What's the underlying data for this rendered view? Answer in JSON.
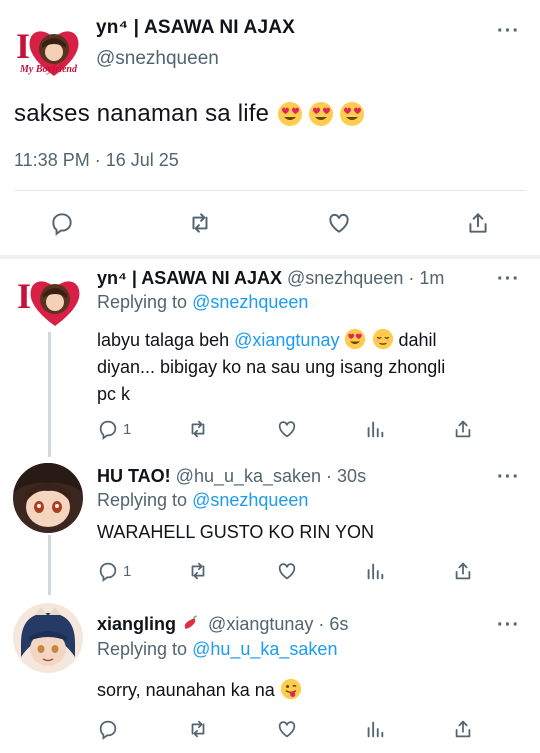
{
  "main_tweet": {
    "display_name": "yn⁴ | ASAWA NI AJAX",
    "handle": "@snezhqueen",
    "text": "sakses nanaman sa life",
    "emojis": [
      "heart-eyes",
      "heart-eyes",
      "heart-eyes"
    ],
    "timestamp": "11:38 PM · 16 Jul 25",
    "avatar_caption": "My Boyfriend",
    "more": "···"
  },
  "replies": [
    {
      "display_name": "yn⁴ | ASAWA NI AJAX",
      "handle_time": "@snezhqueen · 1m",
      "replying_prefix": "Replying to",
      "replying_to": "@snezhqueen",
      "text_line1_pre": "labyu talaga beh",
      "mention": "@xiangtunay",
      "text_line1_post": "dahil",
      "text_line2": "diyan... bibigay ko na sau ung isang zhongli",
      "text_line3": "pc k",
      "reply_count": "1",
      "more": "···"
    },
    {
      "display_name": "HU TAO!",
      "handle_time": "@hu_u_ka_saken · 30s",
      "replying_prefix": "Replying to",
      "replying_to": "@snezhqueen",
      "text": "WARAHELL GUSTO KO RIN YON",
      "reply_count": "1",
      "more": "···"
    },
    {
      "display_name": "xiangling",
      "handle_time": "@xiangtunay · 6s",
      "replying_prefix": "Replying to",
      "replying_to": "@hu_u_ka_saken",
      "text": "sorry, naunahan ka na",
      "more": "···"
    }
  ],
  "colors": {
    "accent": "#1d9bf0",
    "secondary_text": "#536471",
    "divider": "#e4e8eb",
    "thread_line": "#cfd9de"
  }
}
